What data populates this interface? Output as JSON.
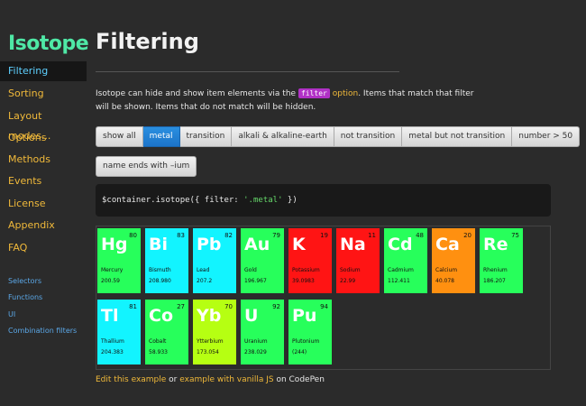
{
  "sidebar": {
    "logo": "Isotope",
    "items": [
      {
        "label": "Filtering",
        "active": true
      },
      {
        "label": "Sorting"
      },
      {
        "label": "Layout modes..."
      },
      {
        "label": "Options"
      },
      {
        "label": "Methods"
      },
      {
        "label": "Events"
      },
      {
        "label": "License"
      },
      {
        "label": "Appendix"
      },
      {
        "label": "FAQ"
      }
    ],
    "sub_items": [
      "Selectors",
      "Functions",
      "UI",
      "Combination filters"
    ]
  },
  "main": {
    "title": "Filtering",
    "intro_before": "Isotope can hide and show item elements via the ",
    "intro_code": "filter",
    "intro_link": "option",
    "intro_after": ". Items that match that filter will be shown. Items that do not match will be hidden.",
    "buttons_row1": [
      "show all",
      "metal",
      "transition",
      "alkali & alkaline-earth",
      "not transition",
      "metal but not transition",
      "number > 50"
    ],
    "active_button": "metal",
    "buttons_row2": [
      "name ends with –ium"
    ],
    "code_prefix": "$container.isotope({ filter: ",
    "code_string": "'.metal'",
    "code_suffix": " })",
    "footer": {
      "link1": "Edit this example",
      "mid": " or ",
      "link2": "example with vanilla JS",
      "end": " on CodePen"
    }
  },
  "elements": [
    {
      "symbol": "Hg",
      "number": "80",
      "name": "Mercury",
      "weight": "200.59",
      "color": "#27ff5b"
    },
    {
      "symbol": "Bi",
      "number": "83",
      "name": "Bismuth",
      "weight": "208.980",
      "color": "#12f4ff"
    },
    {
      "symbol": "Pb",
      "number": "82",
      "name": "Lead",
      "weight": "207.2",
      "color": "#12f4ff"
    },
    {
      "symbol": "Au",
      "number": "79",
      "name": "Gold",
      "weight": "196.967",
      "color": "#27ff5b"
    },
    {
      "symbol": "K",
      "number": "19",
      "name": "Potassium",
      "weight": "39.0983",
      "color": "#ff1414"
    },
    {
      "symbol": "Na",
      "number": "11",
      "name": "Sodium",
      "weight": "22.99",
      "color": "#ff1414"
    },
    {
      "symbol": "Cd",
      "number": "48",
      "name": "Cadmium",
      "weight": "112.411",
      "color": "#27ff5b"
    },
    {
      "symbol": "Ca",
      "number": "20",
      "name": "Calcium",
      "weight": "40.078",
      "color": "#ff9010"
    },
    {
      "symbol": "Re",
      "number": "75",
      "name": "Rhenium",
      "weight": "186.207",
      "color": "#27ff5b"
    },
    {
      "symbol": "Tl",
      "number": "81",
      "name": "Thallium",
      "weight": "204.383",
      "color": "#12f4ff"
    },
    {
      "symbol": "Co",
      "number": "27",
      "name": "Cobalt",
      "weight": "58.933",
      "color": "#27ff5b"
    },
    {
      "symbol": "Yb",
      "number": "70",
      "name": "Ytterbium",
      "weight": "173.054",
      "color": "#b6ff12"
    },
    {
      "symbol": "U",
      "number": "92",
      "name": "Uranium",
      "weight": "238.029",
      "color": "#27ff5b"
    },
    {
      "symbol": "Pu",
      "number": "94",
      "name": "Plutonium",
      "weight": "(244)",
      "color": "#27ff5b"
    }
  ]
}
